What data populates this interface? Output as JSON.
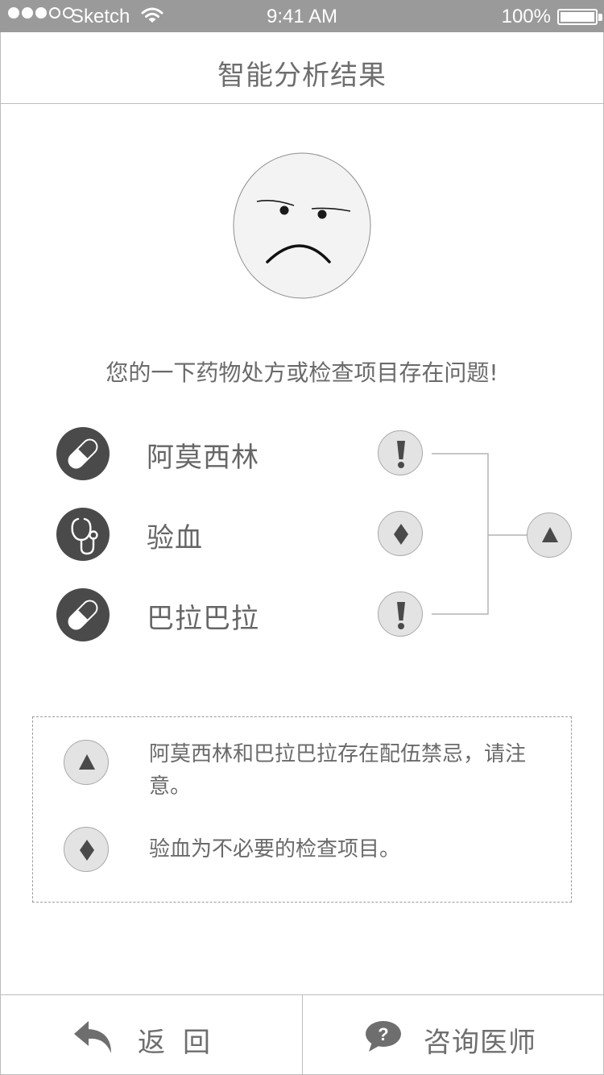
{
  "status_bar": {
    "carrier": "Sketch",
    "time": "9:41 AM",
    "battery": "100%"
  },
  "nav": {
    "title": "智能分析结果"
  },
  "warning": "您的一下药物处方或检查项目存在问题!",
  "items": [
    {
      "label": "阿莫西林",
      "icon": "pill-icon",
      "flag": "exclamation"
    },
    {
      "label": "验血",
      "icon": "stethoscope-icon",
      "flag": "diamond"
    },
    {
      "label": "巴拉巴拉",
      "icon": "pill-icon",
      "flag": "exclamation"
    }
  ],
  "group_flag": "triangle",
  "legend": [
    {
      "symbol": "triangle",
      "text": "阿莫西林和巴拉巴拉存在配伍禁忌，请注意。"
    },
    {
      "symbol": "diamond",
      "text": "验血为不必要的检查项目。"
    }
  ],
  "toolbar": {
    "back_label": "返回",
    "consult_label": "咨询医师"
  },
  "colors": {
    "status_bar": "#9a9a9a",
    "icon_dark": "#4a4a4a",
    "flag_fill": "#e3e3e3",
    "text": "#666666"
  }
}
